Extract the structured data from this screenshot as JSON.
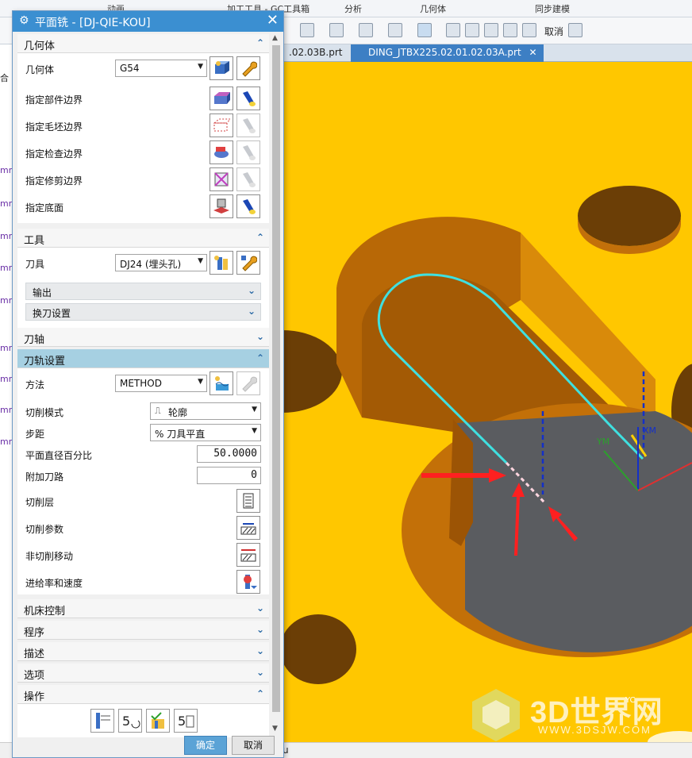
{
  "ribbon": {
    "groups": [
      "动画",
      "加工工具 - GC工具箱",
      "分析",
      "几何体",
      "同步建模"
    ]
  },
  "toolbar": {
    "cancel_label": "取消"
  },
  "tabs": [
    {
      "label": ".02.03B.prt"
    },
    {
      "label": "DING_JTBX225.02.01.02.03A.prt"
    }
  ],
  "left_strip": {
    "items": [
      "合",
      "mm",
      "mm",
      "mm",
      "mm",
      "mm",
      "mm",
      "mm",
      "mm",
      "mm"
    ]
  },
  "dialog": {
    "title": "平面铣 - [DJ-QIE-KOU]",
    "geometry": {
      "header": "几何体",
      "geometry_label": "几何体",
      "geometry_value": "G54",
      "rows": [
        "指定部件边界",
        "指定毛坯边界",
        "指定检查边界",
        "指定修剪边界",
        "指定底面"
      ]
    },
    "tool": {
      "header": "工具",
      "tool_label": "刀具",
      "tool_value": "DJ24 (埋头孔)",
      "output": "输出",
      "tool_change": "换刀设置"
    },
    "axis": {
      "header": "刀轴"
    },
    "path": {
      "header": "刀轨设置",
      "method_label": "方法",
      "method_value": "METHOD",
      "cut_pattern_label": "切削模式",
      "cut_pattern_value": "轮廓",
      "stepover_label": "步距",
      "stepover_value": "% 刀具平直",
      "percent_label": "平面直径百分比",
      "percent_value": "50.0000",
      "extra_label": "附加刀路",
      "extra_value": "0",
      "cut_levels": "切削层",
      "cut_params": "切削参数",
      "non_cut": "非切削移动",
      "feeds": "进给率和速度"
    },
    "machine": {
      "header": "机床控制"
    },
    "program": {
      "header": "程序"
    },
    "description": {
      "header": "描述"
    },
    "options": {
      "header": "选项"
    },
    "actions": {
      "header": "操作"
    },
    "ok_label": "确定",
    "cancel_label": "取消"
  },
  "viewport": {
    "axis_labels": {
      "ym": "YM",
      "xm": "XM",
      "yc": "YC"
    }
  },
  "watermark": {
    "main": "3D世界网",
    "sub": "WWW.3DSJW.COM"
  },
  "status": {
    "text": "u"
  },
  "colors": {
    "accent": "#3b8fd1",
    "part": "#ffc700",
    "floor": "#5a5c60",
    "toolpath": "#3fe0e0",
    "arrow": "#ff2020"
  }
}
